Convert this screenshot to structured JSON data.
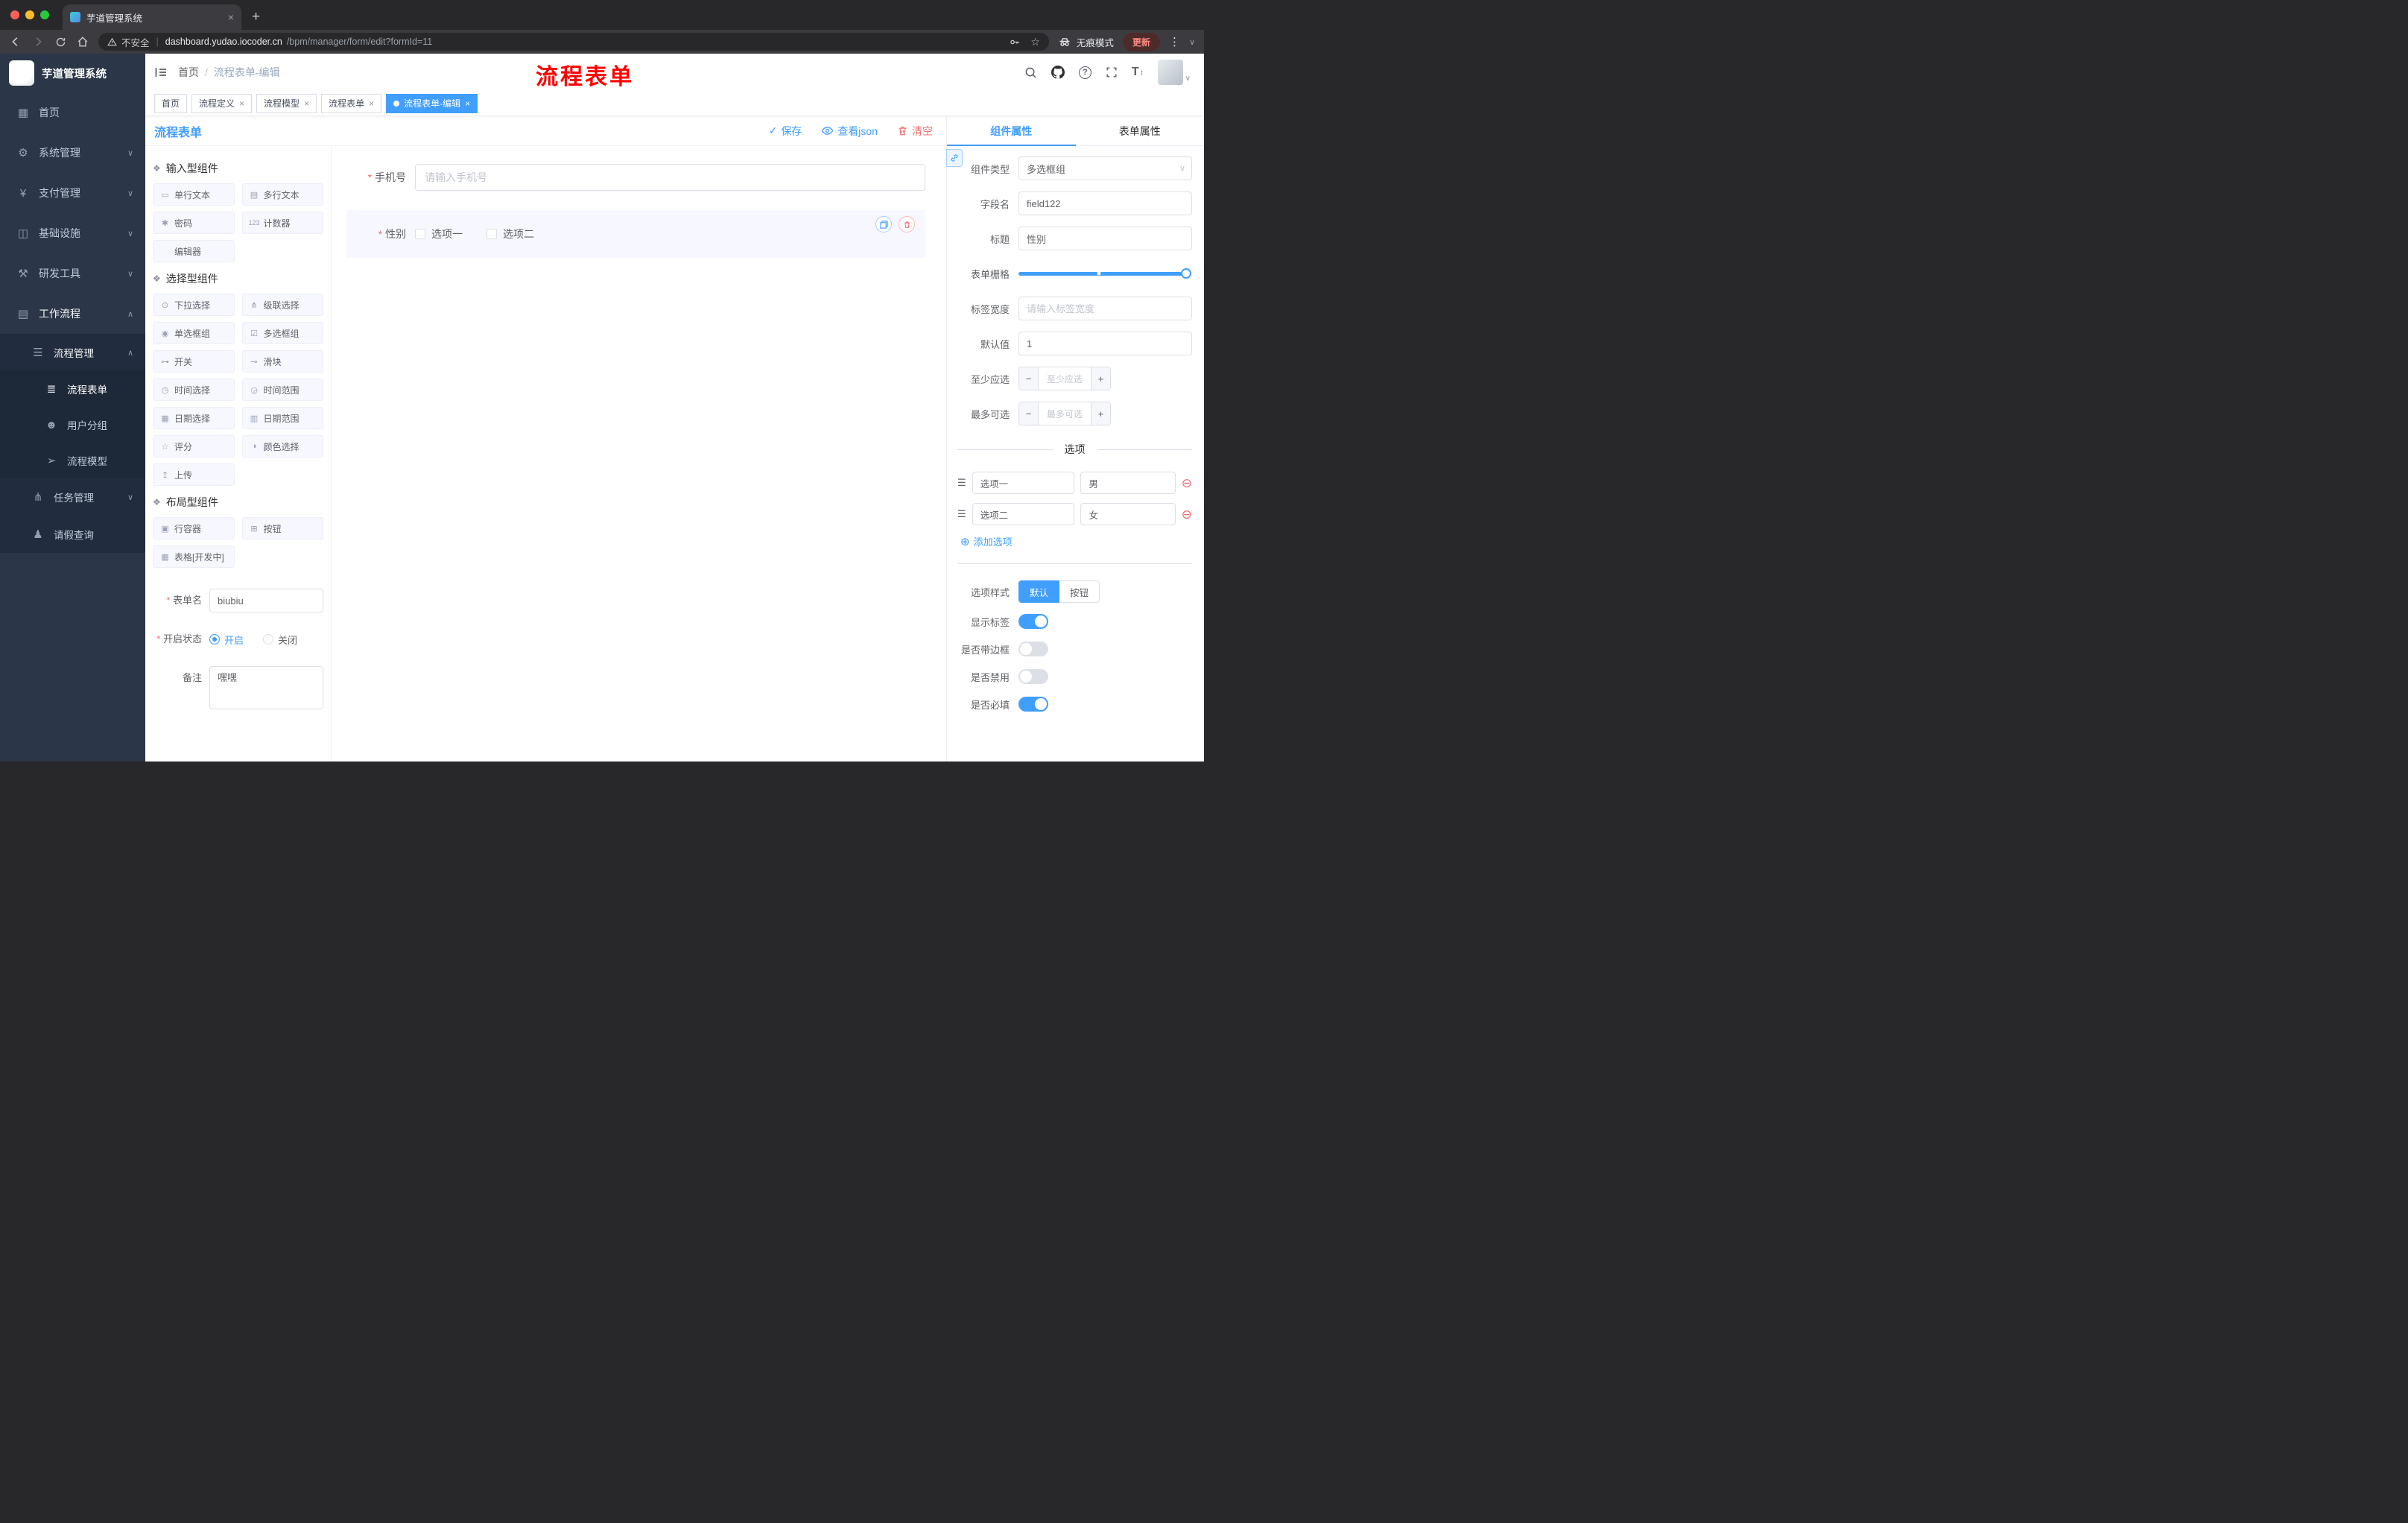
{
  "colors": {
    "primary": "#409eff",
    "danger": "#f56c6c",
    "annotation": "#ff0000",
    "sidebar_bg": "#2b3648",
    "tag_active": "#409eff"
  },
  "icons": {
    "chevron_down": "∨",
    "chevron_up": "∧",
    "drag": "☰",
    "add": "⊕",
    "remove": "⊖",
    "check": "✓",
    "close": "×",
    "plus": "+",
    "minus": "−",
    "kebab": "⋮",
    "star": "☆",
    "group": "❖",
    "help": "?",
    "font_size": "T",
    "arrows_v": "↕",
    "caret_down": "∨",
    "breadcrumb_sep": "/"
  },
  "browser": {
    "tab_title": "芋道管理系统",
    "security_label": "不安全",
    "url_domain": "dashboard.yudao.iocoder.cn",
    "url_path": "/bpm/manager/form/edit?formId=11",
    "incognito_label": "无痕模式",
    "update_label": "更新"
  },
  "sidebar": {
    "logo_title": "芋道管理系统",
    "items": [
      {
        "label": "首页",
        "icon": "▦"
      },
      {
        "label": "系统管理",
        "icon": "⚙"
      },
      {
        "label": "支付管理",
        "icon": "¥"
      },
      {
        "label": "基础设施",
        "icon": "◫"
      },
      {
        "label": "研发工具",
        "icon": "⚒"
      },
      {
        "label": "工作流程",
        "icon": "▤"
      },
      {
        "label": "流程管理",
        "icon": "☰"
      },
      {
        "label": "流程表单",
        "icon": "≣"
      },
      {
        "label": "用户分组",
        "icon": "☻"
      },
      {
        "label": "流程模型",
        "icon": "➢"
      },
      {
        "label": "任务管理",
        "icon": "⋔"
      },
      {
        "label": "请假查询",
        "icon": "♟"
      }
    ]
  },
  "header": {
    "breadcrumb": [
      "首页",
      "流程表单-编辑"
    ],
    "annotation": "流程表单"
  },
  "tags": [
    {
      "label": "首页"
    },
    {
      "label": "流程定义"
    },
    {
      "label": "流程模型"
    },
    {
      "label": "流程表单"
    },
    {
      "label": "流程表单-编辑"
    }
  ],
  "designer": {
    "title": "流程表单",
    "actions": {
      "save": "保存",
      "view_json": "查看json",
      "clear": "清空"
    }
  },
  "palette": {
    "groups": [
      {
        "title": "输入型组件",
        "items": [
          {
            "label": "单行文本",
            "icon": "▭"
          },
          {
            "label": "多行文本",
            "icon": "▤"
          },
          {
            "label": "密码",
            "icon": "✱"
          },
          {
            "label": "计数器",
            "icon": "123"
          },
          {
            "label": "编辑器",
            "icon": ""
          }
        ]
      },
      {
        "title": "选择型组件",
        "items": [
          {
            "label": "下拉选择",
            "icon": "⊙"
          },
          {
            "label": "级联选择",
            "icon": "⋔"
          },
          {
            "label": "单选框组",
            "icon": "◉"
          },
          {
            "label": "多选框组",
            "icon": "☑"
          },
          {
            "label": "开关",
            "icon": "⊶"
          },
          {
            "label": "滑块",
            "icon": "⊸"
          },
          {
            "label": "时间选择",
            "icon": "◷"
          },
          {
            "label": "时间范围",
            "icon": "◶"
          },
          {
            "label": "日期选择",
            "icon": "▦"
          },
          {
            "label": "日期范围",
            "icon": "▥"
          },
          {
            "label": "评分",
            "icon": "☆"
          },
          {
            "label": "颜色选择",
            "icon": "◑"
          },
          {
            "label": "上传",
            "icon": "↥"
          }
        ]
      },
      {
        "title": "布局型组件",
        "items": [
          {
            "label": "行容器",
            "icon": "▣"
          },
          {
            "label": "按钮",
            "icon": "⊞"
          },
          {
            "label": "表格[开发中]",
            "icon": "▦"
          }
        ]
      }
    ],
    "form": {
      "name_label": "表单名",
      "name_value": "biubiu",
      "status_label": "开启状态",
      "status_on": "开启",
      "status_off": "关闭",
      "remark_label": "备注",
      "remark_value": "嘿嘿"
    }
  },
  "canvas": {
    "phone": {
      "label": "手机号",
      "placeholder": "请输入手机号"
    },
    "gender": {
      "label": "性别",
      "options": [
        "选项一",
        "选项二"
      ]
    }
  },
  "props": {
    "tabs": [
      "组件属性",
      "表单属性"
    ],
    "component_type": {
      "label": "组件类型",
      "value": "多选框组"
    },
    "field_name": {
      "label": "字段名",
      "value": "field122"
    },
    "title": {
      "label": "标题",
      "value": "性别"
    },
    "grid": {
      "label": "表单栅格"
    },
    "label_width": {
      "label": "标签宽度",
      "placeholder": "请输入标签宽度"
    },
    "default": {
      "label": "默认值",
      "value": "1"
    },
    "min": {
      "label": "至少应选",
      "placeholder": "至少应选"
    },
    "max": {
      "label": "最多可选",
      "placeholder": "最多可选"
    },
    "options": {
      "title": "选项",
      "rows": [
        {
          "label": "选项一",
          "value": "男"
        },
        {
          "label": "选项二",
          "value": "女"
        }
      ],
      "add": "添加选项"
    },
    "style": {
      "label": "选项样式",
      "default_btn": "默认",
      "button_btn": "按钮"
    },
    "switches": [
      {
        "label": "显示标签"
      },
      {
        "label": "是否带边框"
      },
      {
        "label": "是否禁用"
      },
      {
        "label": "是否必填"
      }
    ]
  }
}
